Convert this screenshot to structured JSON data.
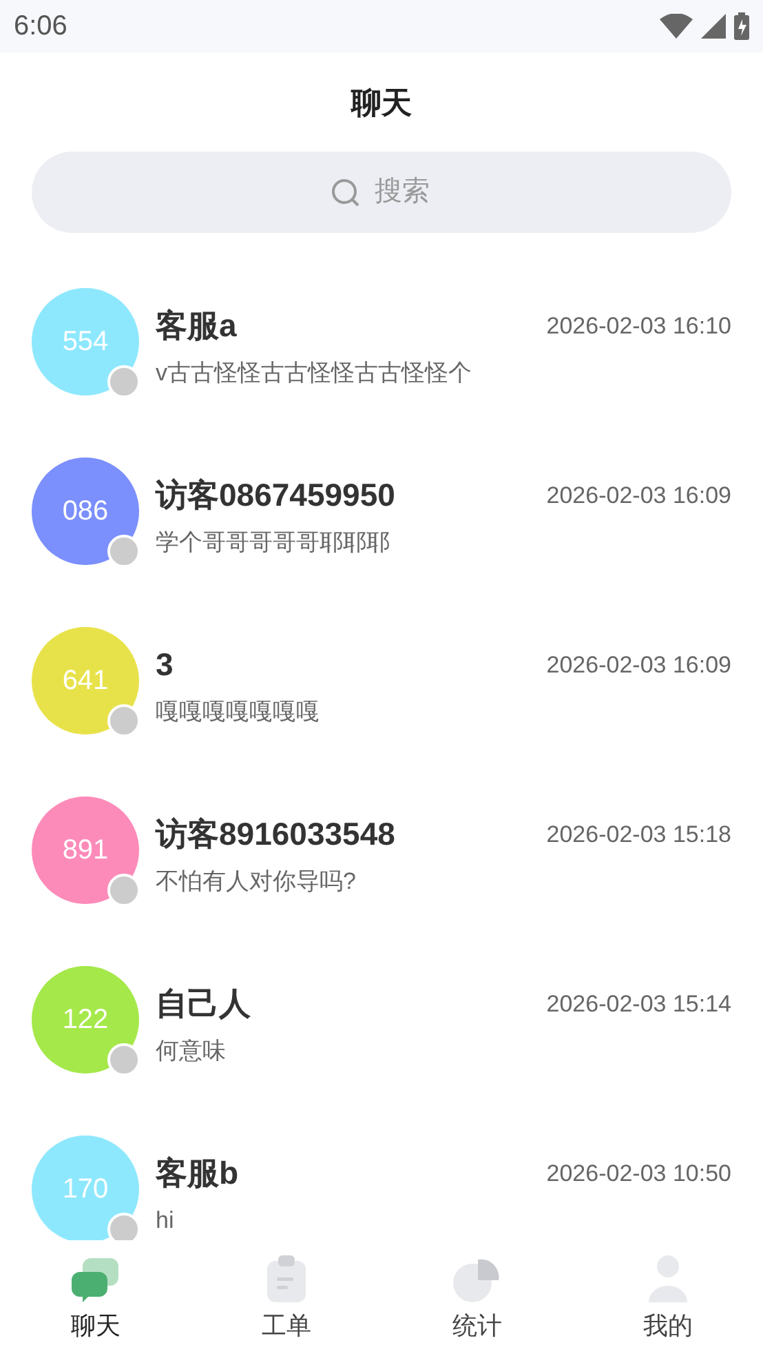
{
  "status_bar": {
    "time": "6:06"
  },
  "header": {
    "title": "聊天"
  },
  "search": {
    "placeholder": "搜索"
  },
  "chats": [
    {
      "avatar": "554",
      "color": "#8ee8fd",
      "name": "客服a",
      "time": "2026-02-03 16:10",
      "preview": "v古古怪怪古古怪怪古古怪怪个"
    },
    {
      "avatar": "086",
      "color": "#7b8ffd",
      "name": "访客0867459950",
      "time": "2026-02-03 16:09",
      "preview": "学个哥哥哥哥哥耶耶耶"
    },
    {
      "avatar": "641",
      "color": "#e8e24a",
      "name": "3",
      "time": "2026-02-03 16:09",
      "preview": "嘎嘎嘎嘎嘎嘎嘎"
    },
    {
      "avatar": "891",
      "color": "#fd8bb9",
      "name": "访客8916033548",
      "time": "2026-02-03 15:18",
      "preview": "不怕有人对你导吗?"
    },
    {
      "avatar": "122",
      "color": "#a5e84a",
      "name": "自己人",
      "time": "2026-02-03 15:14",
      "preview": "何意味"
    },
    {
      "avatar": "170",
      "color": "#8ee8fd",
      "name": "客服b",
      "time": "2026-02-03 10:50",
      "preview": "hi"
    }
  ],
  "bottom_nav": [
    {
      "kind": "chat",
      "label": "聊天",
      "selected": true
    },
    {
      "kind": "ticket",
      "label": "工单",
      "selected": false
    },
    {
      "kind": "stats",
      "label": "统计",
      "selected": false
    },
    {
      "kind": "me",
      "label": "我的",
      "selected": false
    }
  ]
}
